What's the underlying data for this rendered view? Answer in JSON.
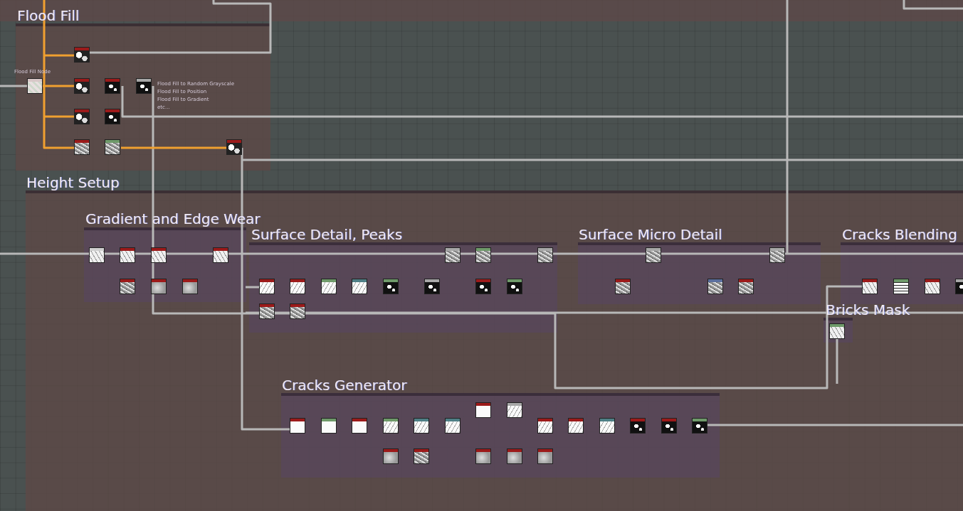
{
  "frames": [
    {
      "title": "Flood Fill",
      "kind": "outer",
      "nodes": [
        {
          "color": "#d8c8c8",
          "kind": "pastel",
          "label": "Flood Fill Node"
        },
        {
          "color": "#9c1a1a",
          "kind": "mask"
        },
        {
          "color": "#9c1a1a",
          "kind": "mask"
        },
        {
          "color": "#9c1a1a",
          "kind": "dark"
        },
        {
          "color": "#a8a8a8",
          "kind": "dark"
        },
        {
          "color": "#9c1a1a",
          "kind": "mask"
        },
        {
          "color": "#9c1a1a",
          "kind": "dark"
        },
        {
          "color": "#9c1a1a",
          "kind": "noise"
        },
        {
          "color": "#6f9a6a",
          "kind": "noise"
        },
        {
          "color": "#9c1a1a",
          "kind": "mask"
        }
      ],
      "comments": [
        "Flood Fill to Random Grayscale",
        "Flood Fill to Position",
        "Flood Fill to Gradient",
        "etc..."
      ]
    },
    {
      "title": "Height Setup",
      "kind": "outer"
    },
    {
      "title": "Gradient and Edge Wear",
      "kind": "inner",
      "nodes": [
        {
          "color": "#d0d0d0",
          "kind": "light"
        },
        {
          "color": "#9c1a1a",
          "kind": "light"
        },
        {
          "color": "#9c1a1a",
          "kind": "light"
        },
        {
          "color": "#9c1a1a",
          "kind": "light"
        },
        {
          "color": "#9c1a1a",
          "kind": "noise"
        },
        {
          "color": "#9c1a1a",
          "kind": "blur"
        },
        {
          "color": "#9c1a1a",
          "kind": "blur"
        }
      ]
    },
    {
      "title": "Surface Detail, Peaks",
      "kind": "inner",
      "nodes": [
        {
          "color": "#9c1a1a",
          "kind": "cracks"
        },
        {
          "color": "#9c1a1a",
          "kind": "cracks"
        },
        {
          "color": "#6f9a6a",
          "kind": "cracks"
        },
        {
          "color": "#4f7f86",
          "kind": "cracks"
        },
        {
          "color": "#6f9a6a",
          "kind": "dark"
        },
        {
          "color": "#a8a8a8",
          "kind": "dark"
        },
        {
          "color": "#a8a8a8",
          "kind": "noise"
        },
        {
          "color": "#6f9a6a",
          "kind": "noise"
        },
        {
          "color": "#a8a8a8",
          "kind": "noise"
        },
        {
          "color": "#9c1a1a",
          "kind": "dark"
        },
        {
          "color": "#6f9a6a",
          "kind": "dark"
        },
        {
          "color": "#9c1a1a",
          "kind": "noise"
        },
        {
          "color": "#9c1a1a",
          "kind": "noise"
        }
      ]
    },
    {
      "title": "Surface Micro Detail",
      "kind": "inner",
      "nodes": [
        {
          "color": "#9c1a1a",
          "kind": "noise"
        },
        {
          "color": "#a8a8a8",
          "kind": "noise"
        },
        {
          "color": "#5b6f9e",
          "kind": "noise"
        },
        {
          "color": "#9c1a1a",
          "kind": "noise"
        },
        {
          "color": "#a8a8a8",
          "kind": "noise"
        }
      ]
    },
    {
      "title": "Cracks Blending",
      "kind": "inner",
      "nodes": [
        {
          "color": "#9c1a1a",
          "kind": "light"
        },
        {
          "color": "#6f9a6a",
          "kind": "cells"
        },
        {
          "color": "#9c1a1a",
          "kind": "light"
        },
        {
          "color": "#a8a8a8",
          "kind": "dark"
        }
      ]
    },
    {
      "title": "Bricks Mask",
      "kind": "inner",
      "nodes": [
        {
          "color": "#6f9a6a",
          "kind": "light"
        }
      ]
    },
    {
      "title": "Cracks Generator",
      "kind": "inner",
      "nodes": [
        {
          "color": "#9c1a1a",
          "kind": "white"
        },
        {
          "color": "#6f9a6a",
          "kind": "white"
        },
        {
          "color": "#9c1a1a",
          "kind": "white"
        },
        {
          "color": "#6f9a6a",
          "kind": "cracks"
        },
        {
          "color": "#4f7f86",
          "kind": "cracks"
        },
        {
          "color": "#4f7f86",
          "kind": "cracks"
        },
        {
          "color": "#9c1a1a",
          "kind": "white"
        },
        {
          "color": "#a8a8a8",
          "kind": "cracks"
        },
        {
          "color": "#9c1a1a",
          "kind": "cracks"
        },
        {
          "color": "#9c1a1a",
          "kind": "cracks"
        },
        {
          "color": "#4f7f86",
          "kind": "cracks"
        },
        {
          "color": "#9c1a1a",
          "kind": "dark"
        },
        {
          "color": "#9c1a1a",
          "kind": "dark"
        },
        {
          "color": "#6f9a6a",
          "kind": "dark"
        },
        {
          "color": "#9c1a1a",
          "kind": "blur"
        },
        {
          "color": "#9c1a1a",
          "kind": "noise"
        },
        {
          "color": "#9c1a1a",
          "kind": "blur"
        },
        {
          "color": "#9c1a1a",
          "kind": "blur"
        },
        {
          "color": "#9c1a1a",
          "kind": "blur"
        }
      ]
    }
  ]
}
